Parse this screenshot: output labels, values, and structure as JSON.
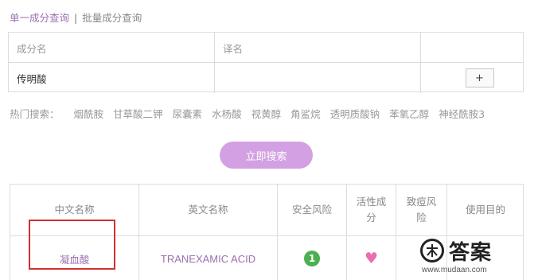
{
  "tabs": {
    "single": "单一成分查询",
    "separator": "|",
    "batch": "批量成分查询"
  },
  "form": {
    "ingredient_placeholder": "成分名",
    "translation_placeholder": "译名",
    "ingredient_value": "传明酸",
    "add_label": "+"
  },
  "hot_search": {
    "label": "热门搜索：",
    "items": [
      "烟酰胺",
      "甘草酸二钾",
      "尿囊素",
      "水杨酸",
      "视黄醇",
      "角鲨烷",
      "透明质酸钠",
      "苯氧乙醇",
      "神经酰胺3"
    ]
  },
  "search_button": "立即搜索",
  "results": {
    "headers": [
      "中文名称",
      "英文名称",
      "安全风险",
      "活性成\n分",
      "致痘风\n险",
      "使用目的"
    ],
    "row": {
      "cn_name": "凝血酸",
      "en_name": "TRANEXAMIC ACID",
      "risk": "1",
      "active_icon": "heart-icon"
    }
  },
  "watermark": {
    "logo_text": "答案",
    "url": "www.mudaan.com"
  },
  "colors": {
    "accent": "#9b6fb0",
    "button": "#d3a1e3",
    "risk_green": "#4caf50",
    "heart": "#e86fb0",
    "highlight": "#d32f2f"
  }
}
